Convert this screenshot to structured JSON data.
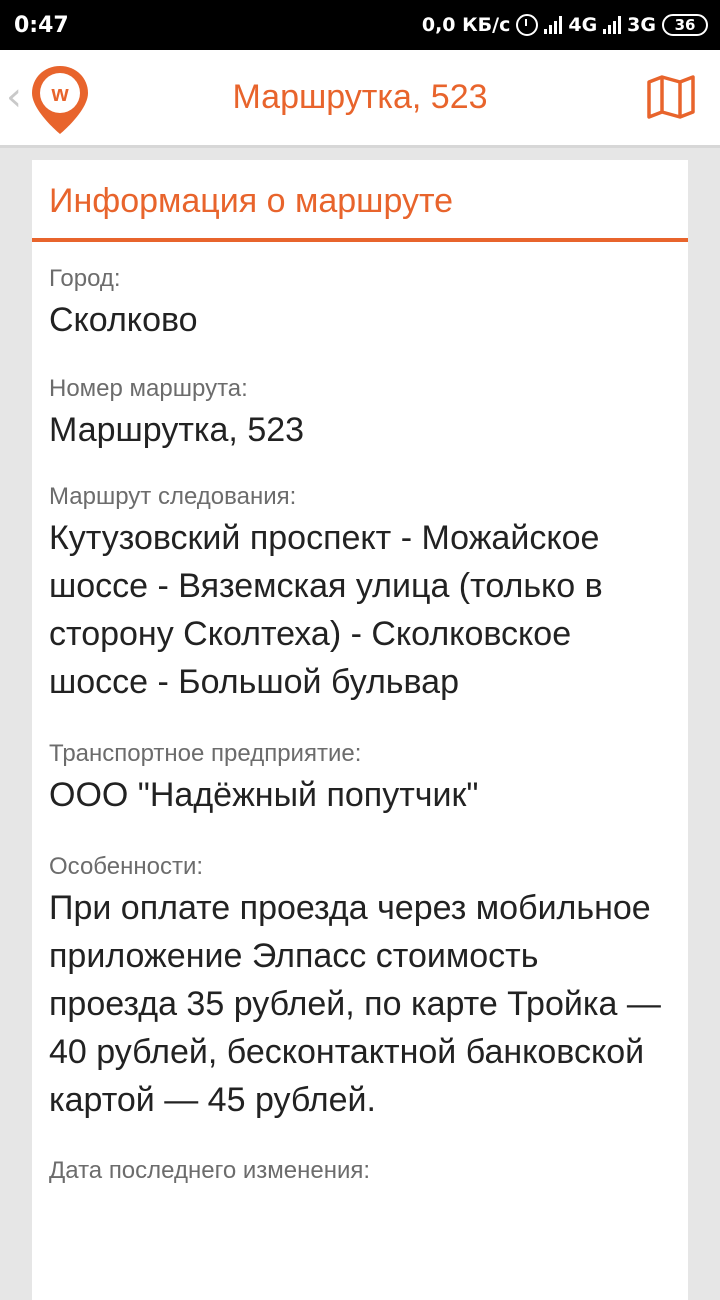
{
  "status_bar": {
    "time": "0:47",
    "speed": "0,0 КБ/с",
    "network1": "4G",
    "network2": "3G",
    "battery": "36"
  },
  "header": {
    "title": "Маршрутка, 523",
    "accent_color": "#e8642c"
  },
  "card": {
    "title": "Информация о маршруте",
    "fields": [
      {
        "label": "Город:",
        "value": "Сколково"
      },
      {
        "label": "Номер маршрута:",
        "value": "Маршрутка, 523"
      },
      {
        "label": "Маршрут следования:",
        "value": "Кутузовский проспект - Можайское шоссе - Вяземская улица (только в сторону Сколтеха) - Сколковское шоссе - Большой бульвар"
      },
      {
        "label": "Транспортное предприятие:",
        "value": "ООО \"Надёжный попутчик\""
      },
      {
        "label": "Особенности:",
        "value": "При оплате проезда через мобильное приложение Элпасс стоимость проезда 35 рублей, по карте Тройка — 40 рублей, бесконтактной банковской картой — 45 рублей."
      },
      {
        "label": "Дата последнего изменения:"
      }
    ]
  }
}
